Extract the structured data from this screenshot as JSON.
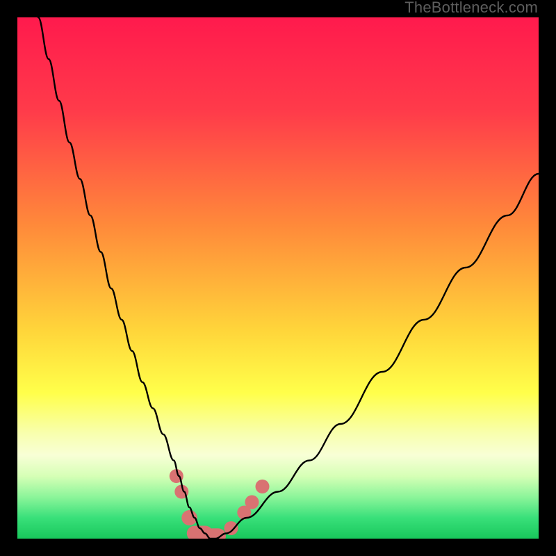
{
  "watermark": "TheBottleneck.com",
  "chart_data": {
    "type": "line",
    "title": "",
    "xlabel": "",
    "ylabel": "",
    "xlim": [
      0,
      100
    ],
    "ylim": [
      0,
      100
    ],
    "gradient_stops": [
      {
        "offset": 0,
        "color": "#ff1a4d"
      },
      {
        "offset": 18,
        "color": "#ff3b4a"
      },
      {
        "offset": 40,
        "color": "#ff8a3a"
      },
      {
        "offset": 60,
        "color": "#ffd53a"
      },
      {
        "offset": 72,
        "color": "#ffff4a"
      },
      {
        "offset": 80,
        "color": "#f8ffb0"
      },
      {
        "offset": 84,
        "color": "#f8ffd6"
      },
      {
        "offset": 88,
        "color": "#d6ffb6"
      },
      {
        "offset": 92,
        "color": "#8cf59a"
      },
      {
        "offset": 96,
        "color": "#39e07a"
      },
      {
        "offset": 100,
        "color": "#18c75c"
      }
    ],
    "series": [
      {
        "name": "bottleneck-curve",
        "x": [
          4,
          6,
          8,
          10,
          12,
          14,
          16,
          18,
          20,
          22,
          24,
          26,
          28,
          30,
          31,
          32,
          33,
          34,
          35,
          36,
          37,
          38,
          40,
          44,
          50,
          56,
          62,
          70,
          78,
          86,
          94,
          100
        ],
        "y": [
          100,
          92,
          84,
          76,
          69,
          62,
          55,
          48,
          42,
          36,
          30,
          25,
          20,
          15,
          12,
          9,
          6,
          4,
          2,
          1,
          0,
          0,
          1,
          4,
          9,
          15,
          22,
          32,
          42,
          52,
          62,
          70
        ]
      }
    ],
    "markers": {
      "name": "highlight-dots",
      "color": "#d97272",
      "points": [
        {
          "x": 30.5,
          "y": 12
        },
        {
          "x": 31.5,
          "y": 9
        },
        {
          "x": 33,
          "y": 4,
          "capsule": true,
          "len": 3
        },
        {
          "x": 35,
          "y": 1,
          "capsule": true,
          "len": 5
        },
        {
          "x": 38,
          "y": 0.5,
          "capsule": true,
          "len": 4
        },
        {
          "x": 41,
          "y": 2
        },
        {
          "x": 43.5,
          "y": 5
        },
        {
          "x": 45,
          "y": 7
        },
        {
          "x": 47,
          "y": 10
        }
      ]
    }
  }
}
